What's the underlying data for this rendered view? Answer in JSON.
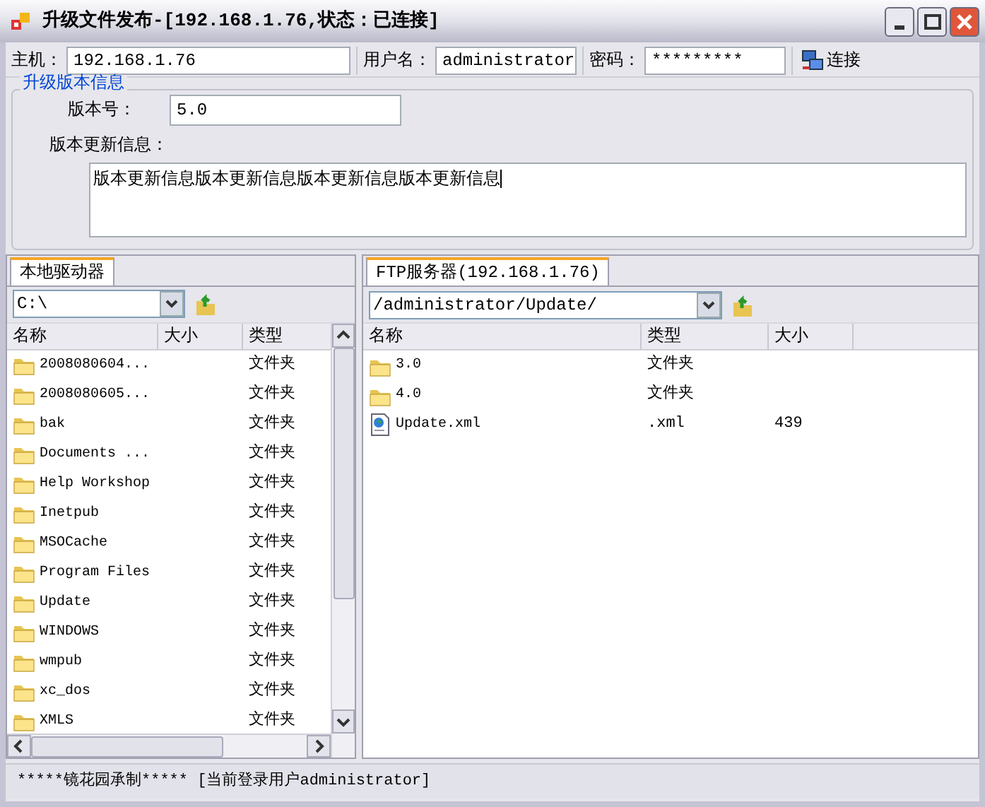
{
  "window": {
    "title": "升级文件发布-[192.168.1.76,状态：已连接]"
  },
  "toolbar": {
    "host_label": "主机：",
    "host": "192.168.1.76",
    "user_label": "用户名：",
    "user": "administrator",
    "password_label": "密码：",
    "password": "*********",
    "connect_button": "连接"
  },
  "version_group": {
    "title": "升级版本信息",
    "version_label": "版本号：",
    "version": "5.0",
    "notes_label": "版本更新信息：",
    "notes": "版本更新信息版本更新信息版本更新信息版本更新信息"
  },
  "local_panel": {
    "tab": "本地驱动器",
    "path": "C:\\",
    "columns": [
      "名称",
      "大小",
      "类型"
    ],
    "rows": [
      {
        "kind": "folder",
        "name": "2008080604...",
        "type": "文件夹"
      },
      {
        "kind": "folder",
        "name": "2008080605...",
        "type": "文件夹"
      },
      {
        "kind": "folder",
        "name": "bak",
        "type": "文件夹"
      },
      {
        "kind": "folder",
        "name": "Documents ...",
        "type": "文件夹"
      },
      {
        "kind": "folder",
        "name": "Help Workshop",
        "type": "文件夹"
      },
      {
        "kind": "folder",
        "name": "Inetpub",
        "type": "文件夹"
      },
      {
        "kind": "folder",
        "name": "MSOCache",
        "type": "文件夹"
      },
      {
        "kind": "folder",
        "name": "Program Files",
        "type": "文件夹"
      },
      {
        "kind": "folder",
        "name": "Update",
        "type": "文件夹"
      },
      {
        "kind": "folder",
        "name": "WINDOWS",
        "type": "文件夹"
      },
      {
        "kind": "folder",
        "name": "wmpub",
        "type": "文件夹"
      },
      {
        "kind": "folder",
        "name": "xc_dos",
        "type": "文件夹"
      },
      {
        "kind": "folder",
        "name": "XMLS",
        "type": "文件夹"
      }
    ]
  },
  "ftp_panel": {
    "tab": "FTP服务器(192.168.1.76)",
    "path": "/administrator/Update/",
    "columns": [
      "名称",
      "类型",
      "大小"
    ],
    "rows": [
      {
        "kind": "folder",
        "name": "3.0",
        "type": "文件夹"
      },
      {
        "kind": "folder",
        "name": "4.0",
        "type": "文件夹"
      },
      {
        "kind": "file",
        "name": "Update.xml",
        "type": ".xml",
        "size": "439"
      }
    ]
  },
  "status_bar": "*****镜花园承制***** [当前登录用户administrator]"
}
